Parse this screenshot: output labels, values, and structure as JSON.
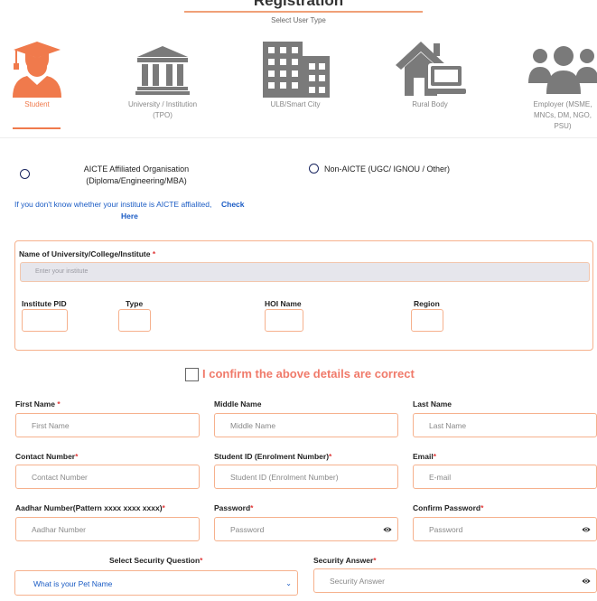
{
  "header": {
    "title": "Registration",
    "subtitle": "Select User Type"
  },
  "user_types": [
    {
      "label": "Student",
      "icon": "graduate-icon",
      "active": true
    },
    {
      "label": "University / Institution (TPO)",
      "icon": "institution-building-icon",
      "active": false
    },
    {
      "label": "ULB/Smart City",
      "icon": "city-buildings-icon",
      "active": false
    },
    {
      "label": "Rural Body",
      "icon": "rural-house-icon",
      "active": false
    },
    {
      "label": "Employer (MSME, MNCs, DM, NGO, PSU)",
      "icon": "people-group-icon",
      "active": false
    }
  ],
  "affiliation": {
    "aicte_label": "AICTE Affiliated Organisation (Diploma/Engineering/MBA)",
    "non_aicte_label": "Non-AICTE (UGC/ IGNOU / Other)",
    "info_text": "If you don't know whether your institute is AICTE affialited,",
    "info_link": "Check Here"
  },
  "institute": {
    "name_label": "Name of University/College/Institute",
    "required_mark": "*",
    "name_placeholder": "Enter your institute",
    "pid_label": "Institute PID",
    "type_label": "Type",
    "hoi_label": "HOI Name",
    "region_label": "Region"
  },
  "confirm": {
    "label": "I confirm the above details are correct"
  },
  "form": {
    "first_name_label": "First Name",
    "first_name_placeholder": "First Name",
    "middle_name_label": "Middle Name",
    "middle_name_placeholder": "Middle Name",
    "last_name_label": "Last Name",
    "last_name_placeholder": "Last Name",
    "contact_label": "Contact Number",
    "contact_placeholder": "Contact Number",
    "student_id_label": "Student ID (Enrolment Number)",
    "student_id_placeholder": "Student ID (Enrolment Number)",
    "email_label": "Email",
    "email_placeholder": "E-mail",
    "aadhar_label": "Aadhar Number(Pattern xxxx xxxx xxxx)",
    "aadhar_placeholder": "Aadhar Number",
    "password_label": "Password",
    "password_placeholder": "Password",
    "confirm_password_label": "Confirm Password",
    "confirm_password_placeholder": "Password",
    "security_question_label": "Select Security Question",
    "security_question_value": "What is your Pet Name",
    "security_answer_label": "Security Answer",
    "security_answer_placeholder": "Security Answer"
  },
  "colors": {
    "accent": "#f07a4c",
    "icon_gray": "#7a7a7a",
    "link_blue": "#1a5bc4",
    "required_red": "#e03a3a"
  }
}
